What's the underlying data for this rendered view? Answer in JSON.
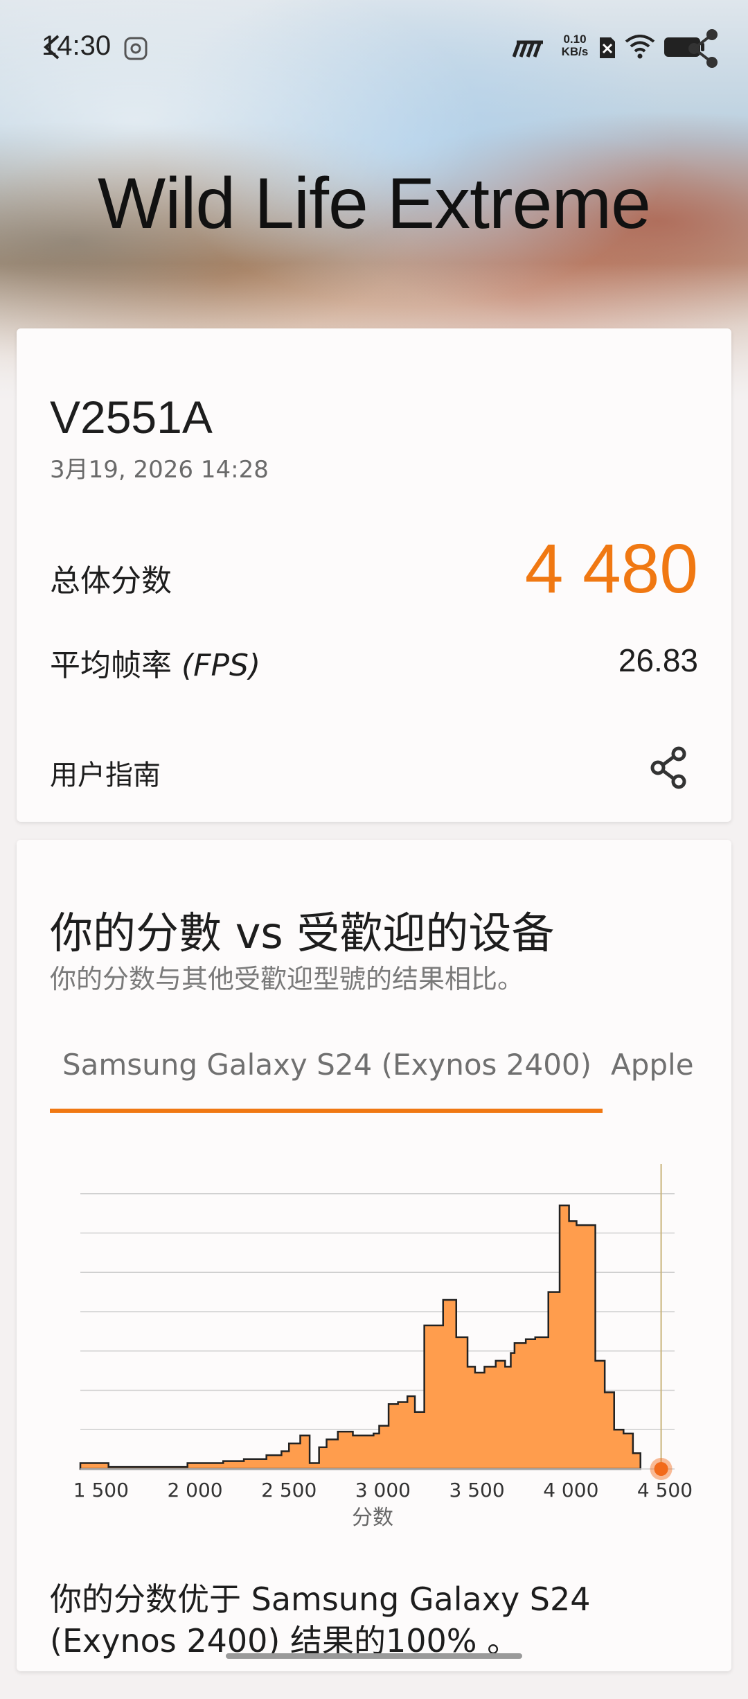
{
  "status_bar": {
    "time": "14:30",
    "net_speed_value": "0.10",
    "net_speed_unit": "KB/s"
  },
  "header": {
    "title": "Wild Life Extreme"
  },
  "result": {
    "device": "V2551A",
    "date": "3月19, 2026 14:28",
    "score_label": "总体分数",
    "score": "4 480",
    "fps_label": "平均帧率",
    "fps_unit": "(FPS)",
    "fps": "26.83",
    "guide_label": "用户指南"
  },
  "comparison": {
    "title": "你的分數 vs 受歡迎的设备",
    "subtitle": "你的分数与其他受歡迎型號的结果相比。",
    "tabs": [
      {
        "label": "Samsung Galaxy S24 (Exynos 2400)",
        "active": true
      },
      {
        "label": "Apple",
        "active": false
      }
    ],
    "verdict": "你的分数优于 Samsung Galaxy S24 (Exynos 2400) 结果的100% 。"
  },
  "colors": {
    "accent": "#f07812",
    "histogram_fill": "#ff9d4d",
    "marker": "#f26a1b"
  },
  "chart_data": {
    "type": "area",
    "xlabel": "分数",
    "x_ticks": [
      1500,
      2000,
      2500,
      3000,
      3500,
      4000,
      4500
    ],
    "x_tick_labels": [
      "1 500",
      "2 000",
      "2 500",
      "3 000",
      "3 500",
      "4 000",
      "4 500"
    ],
    "xlim": [
      1390,
      4500
    ],
    "ylim": [
      0,
      7.4
    ],
    "grid": true,
    "marker_score": 4480,
    "bins": [
      {
        "x": 1390,
        "y": 0.15
      },
      {
        "x": 1540,
        "y": 0.05
      },
      {
        "x": 1960,
        "y": 0.15
      },
      {
        "x": 2150,
        "y": 0.2
      },
      {
        "x": 2260,
        "y": 0.25
      },
      {
        "x": 2380,
        "y": 0.35
      },
      {
        "x": 2460,
        "y": 0.45
      },
      {
        "x": 2500,
        "y": 0.65
      },
      {
        "x": 2560,
        "y": 0.85
      },
      {
        "x": 2610,
        "y": 0.15
      },
      {
        "x": 2660,
        "y": 0.55
      },
      {
        "x": 2700,
        "y": 0.75
      },
      {
        "x": 2760,
        "y": 0.95
      },
      {
        "x": 2840,
        "y": 0.85
      },
      {
        "x": 2950,
        "y": 0.9
      },
      {
        "x": 2980,
        "y": 1.1
      },
      {
        "x": 3030,
        "y": 1.65
      },
      {
        "x": 3080,
        "y": 1.7
      },
      {
        "x": 3130,
        "y": 1.85
      },
      {
        "x": 3170,
        "y": 1.45
      },
      {
        "x": 3220,
        "y": 3.65
      },
      {
        "x": 3320,
        "y": 4.3
      },
      {
        "x": 3390,
        "y": 3.35
      },
      {
        "x": 3450,
        "y": 2.6
      },
      {
        "x": 3490,
        "y": 2.45
      },
      {
        "x": 3540,
        "y": 2.6
      },
      {
        "x": 3600,
        "y": 2.75
      },
      {
        "x": 3650,
        "y": 2.6
      },
      {
        "x": 3680,
        "y": 2.95
      },
      {
        "x": 3700,
        "y": 3.2
      },
      {
        "x": 3760,
        "y": 3.3
      },
      {
        "x": 3810,
        "y": 3.35
      },
      {
        "x": 3880,
        "y": 4.5
      },
      {
        "x": 3940,
        "y": 6.7
      },
      {
        "x": 3990,
        "y": 6.3
      },
      {
        "x": 4030,
        "y": 6.2
      },
      {
        "x": 4130,
        "y": 2.75
      },
      {
        "x": 4180,
        "y": 1.95
      },
      {
        "x": 4230,
        "y": 1.0
      },
      {
        "x": 4280,
        "y": 0.9
      },
      {
        "x": 4330,
        "y": 0.4
      },
      {
        "x": 4370,
        "y": 0.0
      }
    ]
  }
}
